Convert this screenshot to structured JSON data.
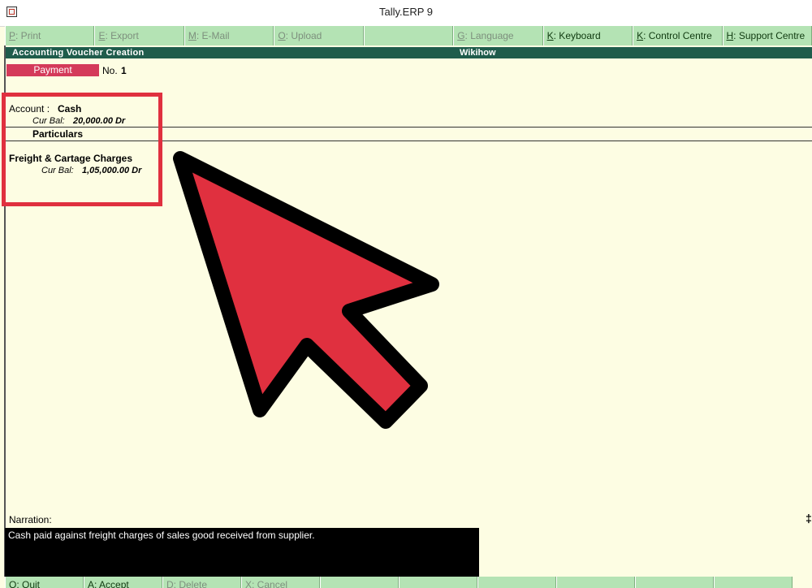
{
  "window": {
    "title": "Tally.ERP 9"
  },
  "toolbar": [
    {
      "key": "P",
      "rest": ": Print",
      "enabled": false
    },
    {
      "key": "E",
      "rest": ": Export",
      "enabled": false
    },
    {
      "key": "M",
      "rest": ": E-Mail",
      "enabled": false
    },
    {
      "key": "O",
      "rest": ": Upload",
      "enabled": false
    },
    {
      "key": "",
      "rest": "",
      "enabled": false
    },
    {
      "key": "G",
      "rest": ": Language",
      "enabled": false
    },
    {
      "key": "K",
      "rest": ": Keyboard",
      "enabled": true
    },
    {
      "key": "K",
      "rest": ": Control Centre",
      "enabled": true
    },
    {
      "key": "H",
      "rest": ": Support Centre",
      "enabled": true
    }
  ],
  "header": {
    "left": "Accounting Voucher  Creation",
    "center": "Wikihow"
  },
  "voucher": {
    "type": "Payment",
    "no_label": "No.",
    "no_value": "1"
  },
  "account": {
    "label": "Account :",
    "value": "Cash",
    "cur_bal_label": "Cur Bal:",
    "cur_bal_value": "20,000.00 Dr"
  },
  "particulars": {
    "heading": "Particulars",
    "ledger": "Freight & Cartage Charges",
    "cur_bal_label": "Cur Bal:",
    "cur_bal_value": "1,05,000.00 Dr"
  },
  "narration": {
    "label": "Narration:",
    "text": "Cash paid against freight charges of sales good received from supplier."
  },
  "footer_buttons": [
    {
      "key": "Q",
      "rest": ": Quit",
      "enabled": true
    },
    {
      "key": "A",
      "rest": ": Accept",
      "enabled": true
    },
    {
      "key": "D",
      "rest": ": Delete",
      "enabled": false
    },
    {
      "key": "X",
      "rest": ": Cancel",
      "enabled": false
    },
    {
      "key": "",
      "rest": "",
      "enabled": false
    },
    {
      "key": "",
      "rest": "",
      "enabled": false
    },
    {
      "key": "",
      "rest": "",
      "enabled": false
    },
    {
      "key": "",
      "rest": "",
      "enabled": false
    },
    {
      "key": "",
      "rest": "",
      "enabled": false
    },
    {
      "key": "",
      "rest": "",
      "enabled": false
    }
  ],
  "right_mark": "‡",
  "colors": {
    "background": "#fdfde3",
    "button_green": "#b4e3b4",
    "header_teal": "#1f5c4c",
    "voucher_type_red": "#d43a5a",
    "highlight_red": "#e0303f",
    "arrow_red": "#e0303f"
  },
  "icons": {
    "app": "tally-app-icon",
    "overlay": "cursor-arrow-icon"
  }
}
